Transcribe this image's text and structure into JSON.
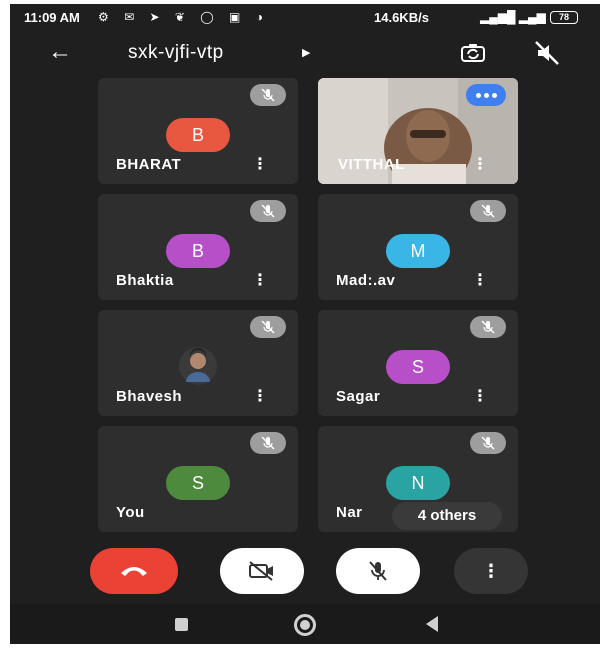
{
  "status_bar": {
    "time": "11:09 AM",
    "icons": [
      "settings-icon",
      "message-icon",
      "telegram-icon",
      "twitter-icon",
      "whatsapp-icon",
      "news-icon",
      "photo-icon"
    ],
    "speed": "14.6KB/s",
    "signal": "4G",
    "battery": "78"
  },
  "header": {
    "meeting_code": "sxk-vjfi-vtp",
    "back_icon": "arrow-left-icon",
    "switch_camera_icon": "switch-camera-icon",
    "speaker_icon": "speaker-off-icon"
  },
  "participants": [
    {
      "name": "BHARAT",
      "initial": "B",
      "color": "#e8573f",
      "muted": true
    },
    {
      "name": "VITTHAL",
      "video": true,
      "speaking": true,
      "color": "#3f7ff0"
    },
    {
      "name": "Bhaktia",
      "initial": "B",
      "color": "#b64fc8",
      "muted": true
    },
    {
      "name": "Madhav",
      "display_name": "Mad:.av",
      "initial": "M",
      "color": "#39b6e6",
      "muted": true
    },
    {
      "name": "Bhavesh",
      "photo": true,
      "muted": true
    },
    {
      "name": "Sagar",
      "initial": "S",
      "color": "#b64fc8",
      "muted": true
    },
    {
      "name": "You",
      "initial": "S",
      "color": "#4e8a3e",
      "muted": true
    },
    {
      "name": "Nar",
      "initial": "N",
      "color": "#2aa3a3",
      "muted": true
    }
  ],
  "others_label": "4 others",
  "controls": {
    "end_call": "end-call-icon",
    "camera": "camera-off-icon",
    "mic": "mic-off-icon",
    "more": "⋮"
  },
  "colors": {
    "background": "#1f1f1f",
    "tile": "#2e2e2e",
    "end_call": "#ea4335",
    "mute_badge": "#9e9e9e",
    "speaking": "#3f7ff0"
  }
}
